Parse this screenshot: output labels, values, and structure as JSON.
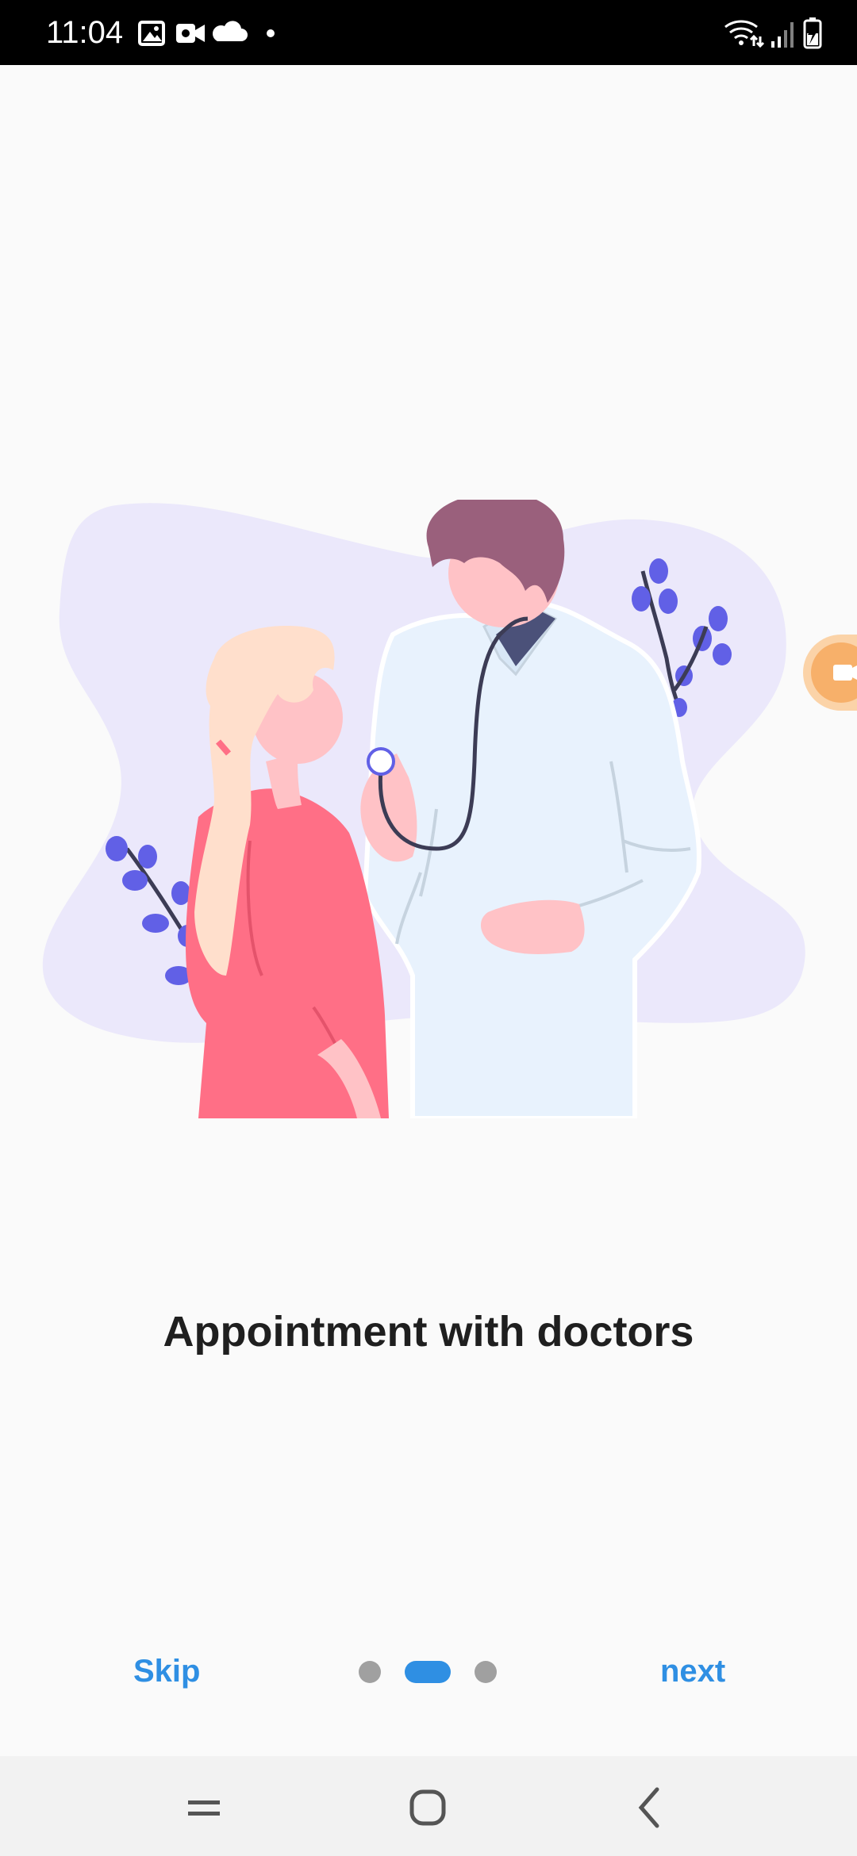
{
  "status_bar": {
    "time": "11:04",
    "left_icons": [
      "gallery-icon",
      "video-icon",
      "cloud-icon",
      "dot-icon"
    ],
    "right_icons": [
      "wifi-icon",
      "signal-icon",
      "battery-charging-icon"
    ]
  },
  "onboarding": {
    "title": "Appointment with doctors",
    "skip_label": "Skip",
    "next_label": "next",
    "page_count": 3,
    "active_page": 2
  },
  "nav_bar": {
    "icons": [
      "recent-apps-icon",
      "home-icon",
      "back-icon"
    ]
  },
  "colors": {
    "accent": "#2f8fe3",
    "title": "#1f1f1f",
    "background": "#fafafa",
    "blob": "#ebe8fb",
    "leaf": "#6160e6",
    "coat": "#e8f2fd",
    "shirt": "#ff6f86",
    "skin": "#ffc2c6",
    "hair_man": "#9a607c",
    "hair_woman": "#ffdfcc"
  }
}
